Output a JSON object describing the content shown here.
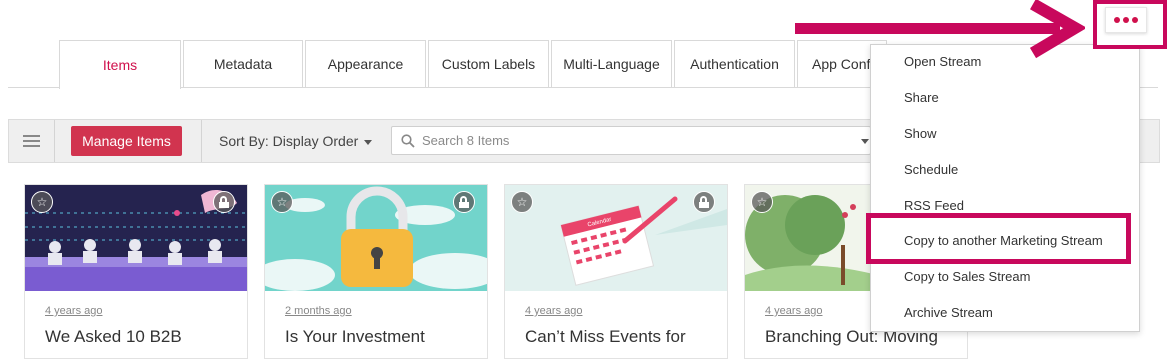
{
  "tabs": [
    {
      "label": "Items",
      "active": true
    },
    {
      "label": "Metadata"
    },
    {
      "label": "Appearance"
    },
    {
      "label": "Custom Labels"
    },
    {
      "label": "Multi-Language"
    },
    {
      "label": "Authentication"
    },
    {
      "label": "App Config"
    }
  ],
  "toolbar": {
    "manage_label": "Manage Items",
    "sort_label": "Sort By: Display Order",
    "search_placeholder": "Search 8 Items"
  },
  "cards": [
    {
      "date": "4 years ago",
      "title": "We Asked 10 B2B"
    },
    {
      "date": "2 months ago",
      "title": "Is Your Investment"
    },
    {
      "date": "4 years ago",
      "title": "Can’t Miss Events for"
    },
    {
      "date": "4 years ago",
      "title": "Branching Out: Moving"
    }
  ],
  "calendar_label": "Calendar",
  "menu": {
    "items": [
      "Open Stream",
      "Share",
      "Show",
      "Schedule",
      "RSS Feed",
      "Copy to another Marketing Stream",
      "Copy to Sales Stream",
      "Archive Stream"
    ],
    "highlighted_index": 5
  },
  "colors": {
    "accent": "#d0104c",
    "annotation": "#c8085c",
    "manage_button": "#d1344f"
  }
}
